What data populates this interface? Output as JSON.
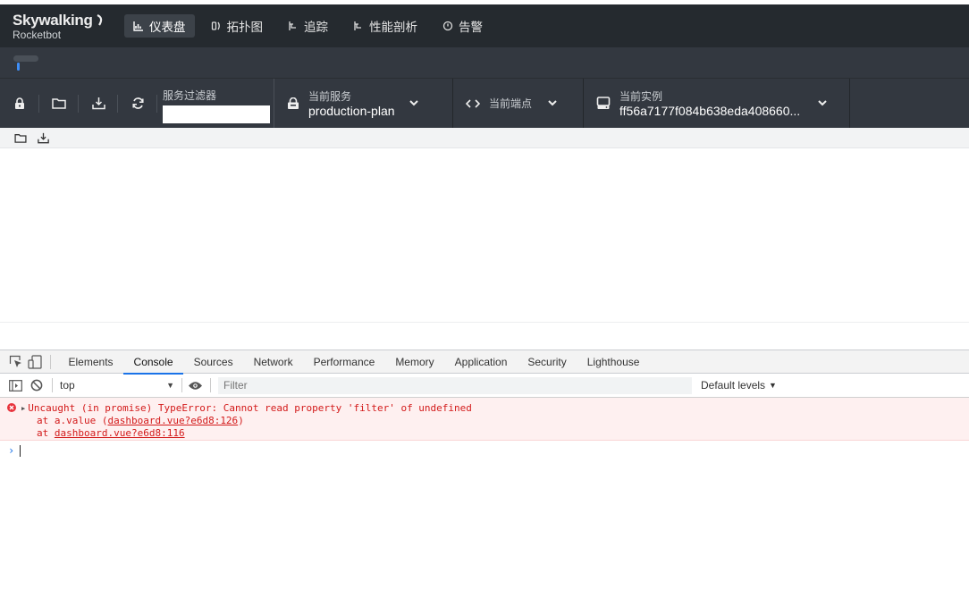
{
  "brand": {
    "name": "Skywalking",
    "sub": "Rocketbot"
  },
  "nav": {
    "items": [
      {
        "label": "仪表盘",
        "icon": "chart-icon",
        "active": true
      },
      {
        "label": "拓扑图",
        "icon": "topology-icon",
        "active": false
      },
      {
        "label": "追踪",
        "icon": "trace-icon",
        "active": false
      },
      {
        "label": "性能剖析",
        "icon": "profile-icon",
        "active": false
      },
      {
        "label": "告警",
        "icon": "alarm-icon",
        "active": false
      }
    ]
  },
  "toolbar": {
    "filter_label": "服务过滤器",
    "filter_value": "",
    "service_label": "当前服务",
    "service_value": "production-plan",
    "endpoint_label": "当前端点",
    "instance_label": "当前实例",
    "instance_value": "ff56a7177f084b638eda408660..."
  },
  "devtools": {
    "tabs": [
      "Elements",
      "Console",
      "Sources",
      "Network",
      "Performance",
      "Memory",
      "Application",
      "Security",
      "Lighthouse"
    ],
    "active_tab": "Console",
    "context": "top",
    "filter_placeholder": "Filter",
    "levels": "Default levels",
    "error": {
      "message": "Uncaught (in promise) TypeError: Cannot read property 'filter' of undefined",
      "stack1_prefix": "at a.value (",
      "stack1_link": "dashboard.vue?e6d8:126",
      "stack1_suffix": ")",
      "stack2_prefix": "at ",
      "stack2_link": "dashboard.vue?e6d8:116"
    },
    "prompt": "›"
  },
  "colors": {
    "nav_bg": "#252a2f",
    "toolbar_bg": "#333840",
    "accent": "#1a73e8",
    "error": "#d31a1a"
  }
}
